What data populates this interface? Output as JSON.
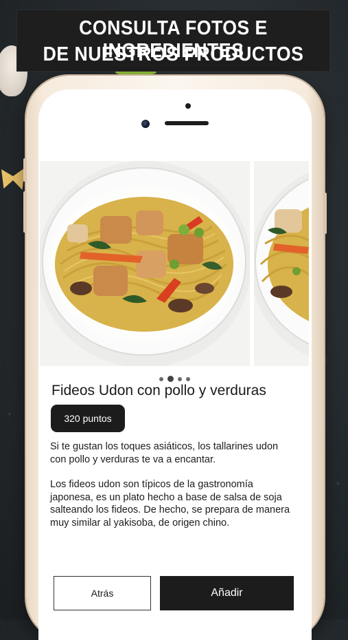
{
  "banner": {
    "line1": "CONSULTA FOTOS E INGREDIENTES",
    "line2": "DE NUESTROS PRODUCTOS"
  },
  "product": {
    "title": "Fideos Udon con pollo y verduras",
    "points": "320 puntos",
    "description_1": "Si te gustan los toques asiáticos, los tallarines udon con pollo y verduras te va a encantar.",
    "description_2": "Los fideos udon son típicos de la gastronomía japonesa, es un plato hecho a base de salsa de soja salteando los fideos. De hecho, se prepara de manera muy similar al yakisoba, de origen chino."
  },
  "carousel": {
    "dot_count": 4,
    "active_index": 1
  },
  "actions": {
    "back_label": "Atrás",
    "add_label": "Añadir"
  },
  "colors": {
    "background": "#262b2f",
    "banner": "#1e1e1e",
    "phone_frame": "#f6ebdd",
    "primary_button": "#1c1c1c",
    "badge": "#1c1c1c"
  },
  "icons": {
    "front_camera": "camera-lens-icon",
    "speaker": "speaker-grille-icon"
  }
}
